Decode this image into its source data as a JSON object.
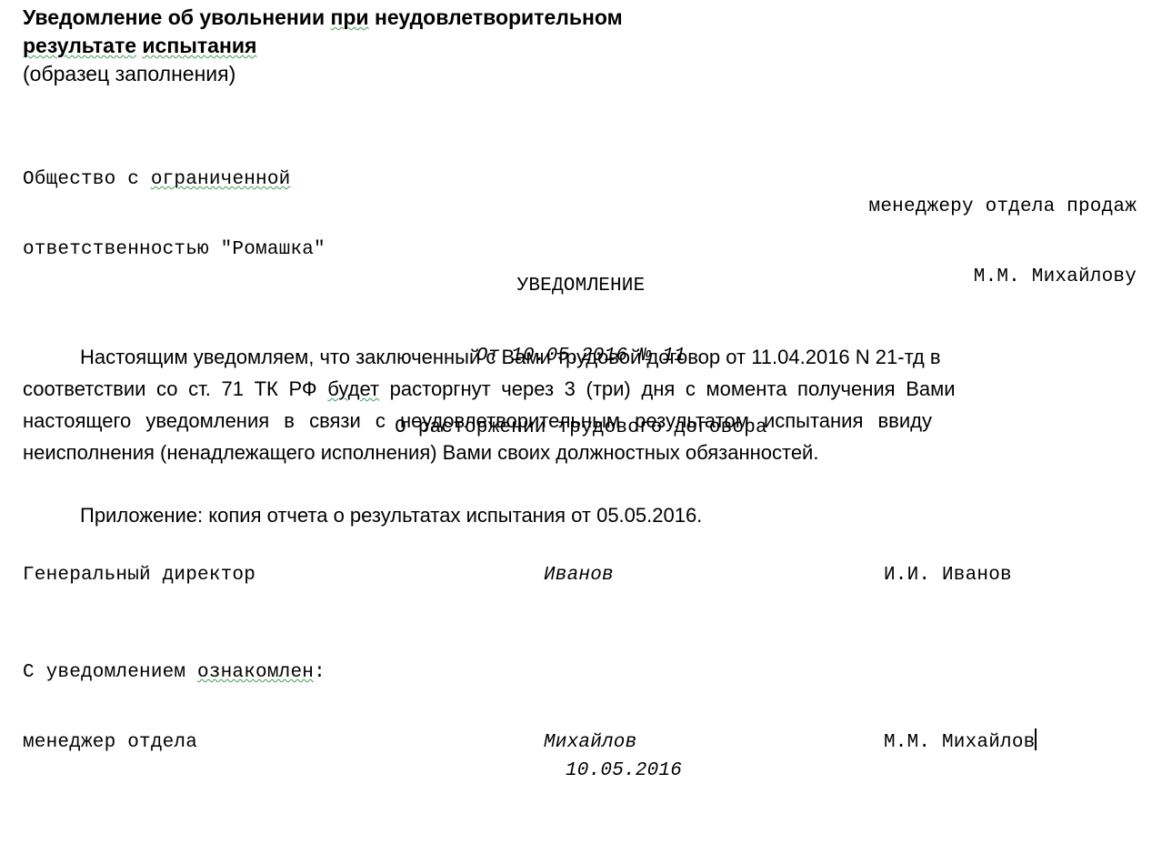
{
  "document": {
    "title_lines": [
      "Уведомление об увольнении при неудовлетворительном",
      "результате испытания",
      "(образец заполнения)"
    ],
    "title_spellcheck_words": [
      "при",
      "результате",
      "испытания"
    ],
    "organization": {
      "line1": "Общество с ограниченной",
      "line2": "ответственностью \"Ромашка\"",
      "spellcheck_word": "ограниченной"
    },
    "addressee": {
      "line1": "менеджеру отдела продаж",
      "line2": "М.М. Михайлову"
    },
    "heading": {
      "type": "УВЕДОМЛЕНИЕ",
      "date_number": "От 10.05.2016 № 11",
      "subject": "О расторжении трудового договора"
    },
    "body": {
      "line1": "Настоящим уведомляем, что заключенный с Вами трудовой договор от 11.04.2016 N 21-тд в",
      "line2_before": "соответствии со ст. 71 ТК РФ ",
      "line2_spell": "будет",
      "line2_after": " расторгнут через 3 (три) дня с момента получения Вами",
      "line3": "настоящего уведомления в связи с неудовлетворительным результатом испытания ввиду",
      "line4": "неисполнения (ненадлежащего исполнения) Вами своих должностных обязанностей."
    },
    "attachment": "Приложение: копия отчета о результатах испытания от 05.05.2016.",
    "director_signature": {
      "role": "Генеральный директор",
      "signature": "Иванов",
      "name": "И.И. Иванов"
    },
    "acknowledgement": {
      "intro_before": "С уведомлением ",
      "intro_spell": "ознакомлен",
      "intro_after": ":",
      "role": "менеджер отдела",
      "signature": "Михайлов",
      "name": "М.М. Михайлов",
      "date": "10.05.2016"
    },
    "colors": {
      "text": "#000000",
      "background": "#ffffff",
      "spellcheck_underline": "#3f9c52",
      "caret": "#000000"
    }
  }
}
